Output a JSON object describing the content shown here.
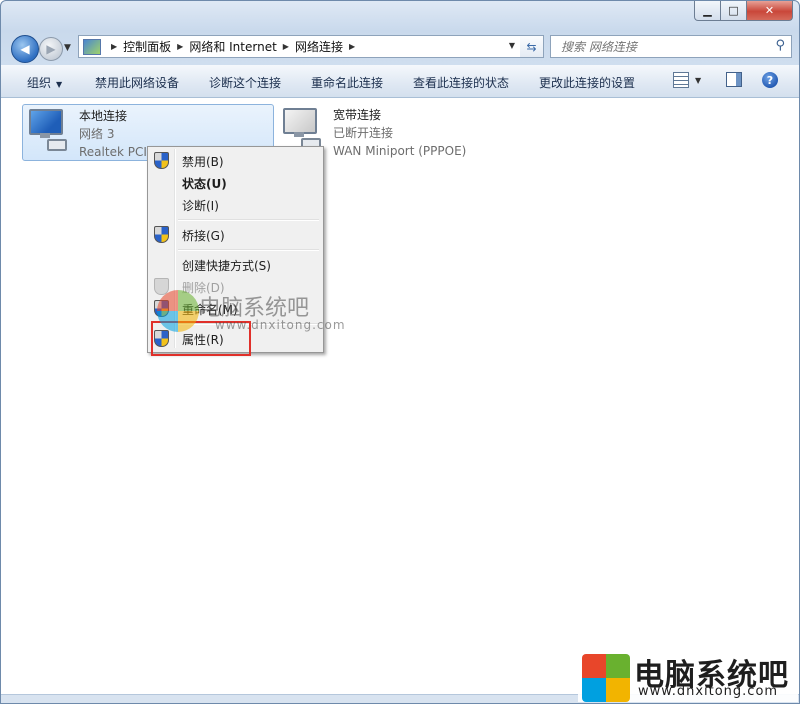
{
  "titlebar": {
    "minimize": "▁",
    "maximize": "□",
    "close": "✕"
  },
  "address": {
    "crumbs": [
      "控制面板",
      "网络和 Internet",
      "网络连接"
    ],
    "search_placeholder": "搜索 网络连接"
  },
  "toolbar": {
    "organize": "组织",
    "disable": "禁用此网络设备",
    "diagnose": "诊断这个连接",
    "rename": "重命名此连接",
    "view_status": "查看此连接的状态",
    "change_settings": "更改此连接的设置"
  },
  "connections": [
    {
      "name": "本地连接",
      "network": "网络  3",
      "adapter": "Realtek PCIe GBE Family C",
      "icon": "network-adapter-connected-icon"
    },
    {
      "name": "宽带连接",
      "status": "已断开连接",
      "adapter": "WAN Miniport (PPPOE)",
      "icon": "network-adapter-disconnected-icon"
    }
  ],
  "context_menu": {
    "items": [
      {
        "label": "禁用(B)"
      },
      {
        "label": "状态(U)"
      },
      {
        "label": "诊断(I)"
      },
      {
        "label": "桥接(G)"
      },
      {
        "label": "创建快捷方式(S)"
      },
      {
        "label": "删除(D)"
      },
      {
        "label": "重命名(M)"
      },
      {
        "label": "属性(R)"
      }
    ],
    "highlighted_item": "属性(R)",
    "highlight_color": "#e0302a"
  },
  "watermark": {
    "title": "电脑系统吧",
    "url": "www.dnxitong.com"
  },
  "colors": {
    "accent": "#2f6fc2",
    "toolbar_text": "#1c2f4e",
    "selection": "#d3e6fa"
  }
}
